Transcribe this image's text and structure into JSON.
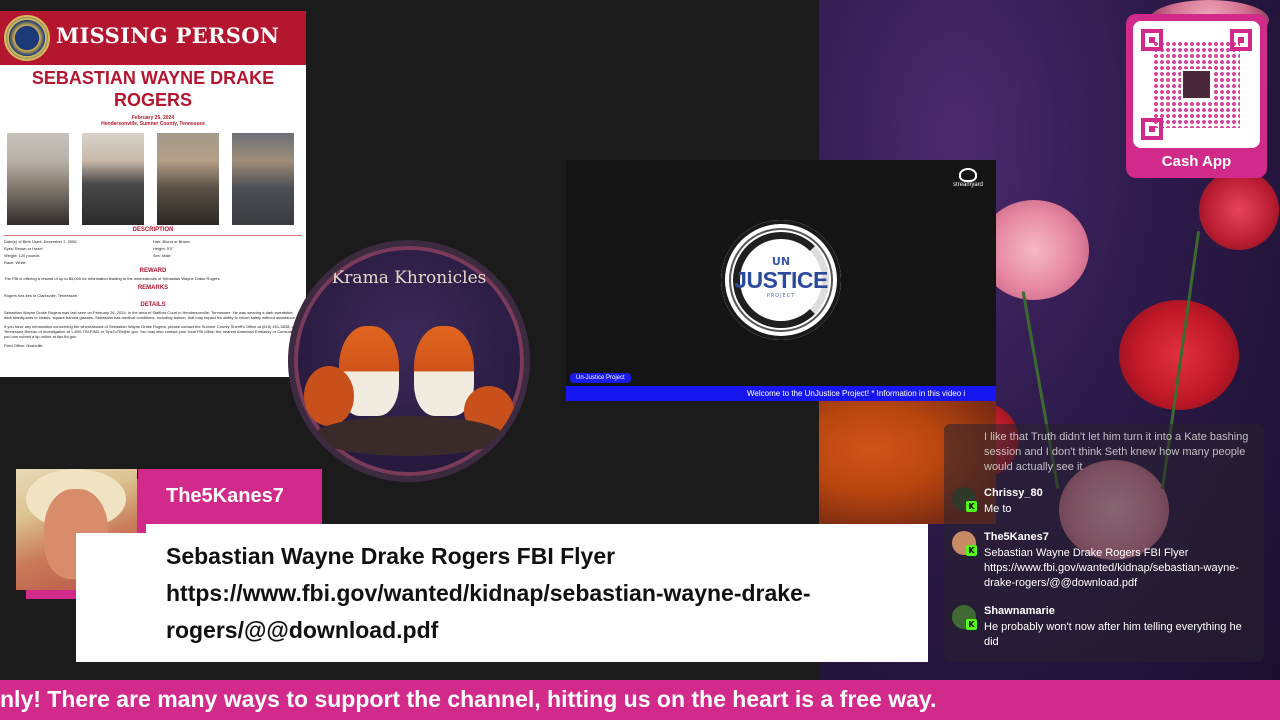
{
  "flyer": {
    "header": "MISSING PERSON",
    "name_line1": "SEBASTIAN WAYNE DRAKE",
    "name_line2": "ROGERS",
    "date": "February 26, 2024",
    "place": "Hendersonville, Sumner County, Tennessee",
    "description_heading": "DESCRIPTION",
    "desc": {
      "dob": "Date(s) of Birth Used: December 7, 2008",
      "hair": "Hair: Blond or Brown",
      "eyes": "Eyes: Brown or Hazel",
      "height": "Height: 5'0\"",
      "weight": "Weight: 120 pounds",
      "sex": "Sex: Male",
      "race": "Race: White"
    },
    "reward_heading": "REWARD",
    "reward_text": "The FBI is offering a reward of up to $5,000 for information leading to the whereabouts of Sebastian Wayne Drake Rogers.",
    "remarks_heading": "REMARKS",
    "remarks_text": "Rogers has ties to Clarksville, Tennessee.",
    "details_heading": "DETAILS",
    "details_text": "Sebastian Wayne Drake Rogers was last seen on February 26, 2024, in the area of Stafford Court in Hendersonville, Tennessee. He was wearing a dark sweatshirt, dark sweatpants or khakis, square framed glasses. Sebastian has medical conditions, including autism, that may impact his ability to return safely without assistance.",
    "contact_text": "If you have any information concerning the whereabouts of Sebastian Wayne Drake Rogers, please contact the Sumner County Sheriff's Office at (615) 451-3838, or the Tennessee Bureau of Investigation at 1-800-TBI-FIND or TipsToTBI@tn.gov. You may also contact your local FBI office, the nearest American Embassy or Consulate, or you can submit a tip online at tips.fbi.gov.",
    "field_office": "Field Office: Nashville"
  },
  "krama": {
    "title": "Krama Khronicles"
  },
  "stream": {
    "brand": "streamyard",
    "logo_un": "UN",
    "logo_justice": "JUSTICE",
    "logo_project": "PROJECT",
    "tag": "Un-Justice Project",
    "ticker": "Welcome to the UnJustice Project! * Information in this video i"
  },
  "cashapp": {
    "label": "Cash App"
  },
  "chat": {
    "faded_message": "I like that Truth didn't let him turn it into a Kate bashing session and I don't think Seth knew how many people would actually see it",
    "messages": [
      {
        "user": "Chrissy_80",
        "text": "Me to",
        "avatar_color": "#2f3a2a"
      },
      {
        "user": "The5Kanes7",
        "text": "Sebastian Wayne Drake Rogers FBI Flyer https://www.fbi.gov/wanted/kidnap/sebastian-wayne-drake-rogers/@@download.pdf",
        "avatar_color": "#c98a66"
      },
      {
        "user": "Shawnamarie",
        "text": "He probably won't now after him telling everything he did",
        "avatar_color": "#3f6a34"
      }
    ],
    "badge_glyph": "K"
  },
  "featured": {
    "username": "The5Kanes7",
    "badge_glyph": "K",
    "message": "Sebastian Wayne Drake Rogers FBI Flyer https://www.fbi.gov/wanted/kidnap/sebastian-wayne-drake-rogers/@@download.pdf"
  },
  "ticker": {
    "text": "nly! There are many ways to support the channel, hitting us on the heart is a free way."
  },
  "colors": {
    "accent_pink": "#d12a8a",
    "fbi_red": "#b4152f",
    "kick_green": "#53fc18",
    "ticker_blue": "#1616f0"
  }
}
